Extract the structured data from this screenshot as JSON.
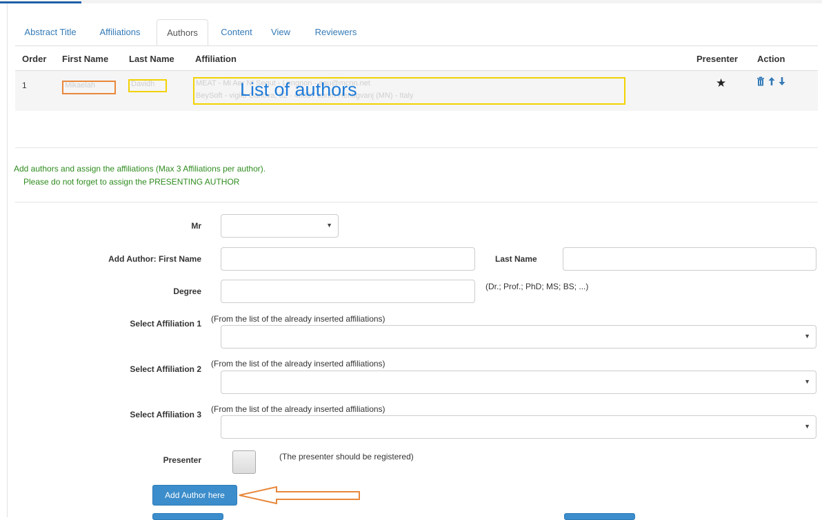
{
  "tabs": [
    {
      "label": "Abstract Title"
    },
    {
      "label": "Affiliations"
    },
    {
      "label": "Authors"
    },
    {
      "label": "Content"
    },
    {
      "label": "View"
    },
    {
      "label": "Reviewers"
    }
  ],
  "table": {
    "headers": {
      "order": "Order",
      "first_name": "First Name",
      "last_name": "Last Name",
      "affiliation": "Affiliation",
      "presenter": "Presenter",
      "action": "Action"
    },
    "rows": [
      {
        "order": "1",
        "first_name": "Mikaelah",
        "last_name": "Davidh",
        "affiliation_line1": "MEAT - Mi          Aer         Nl        Segut - Lengnon - aau@mcnn.net",
        "affiliation_line2": "BeySoft -                                            vigilo Canova, 62 - 46087 conm Hentigvanj (MN) - Italy",
        "presenter_icon": "star-icon"
      }
    ],
    "annotation": "List of authors"
  },
  "notes": {
    "line1": "Add authors and assign the affiliations (Max 3 Affiliations per author).",
    "line2": "Please do not forget to assign the PRESENTING AUTHOR"
  },
  "form": {
    "title_label": "Mr",
    "title_value": "",
    "first_name_label": "Add Author: First Name",
    "first_name_value": "",
    "last_name_label": "Last Name",
    "last_name_value": "",
    "degree_label": "Degree",
    "degree_value": "",
    "degree_hint": "(Dr.; Prof.; PhD; MS; BS; ...)",
    "affiliations": [
      {
        "label": "Select Affiliation 1",
        "hint": "(From the list of the already inserted affiliations)",
        "value": ""
      },
      {
        "label": "Select Affiliation 2",
        "hint": "(From the list of the already inserted affiliations)",
        "value": ""
      },
      {
        "label": "Select Affiliation 3",
        "hint": "(From the list of the already inserted affiliations)",
        "value": ""
      }
    ],
    "presenter_label": "Presenter",
    "presenter_hint": "(The presenter should be registered)",
    "add_button": "Add Author here"
  },
  "colors": {
    "link": "#337ab7",
    "note_green": "#2e8b1e",
    "button_blue": "#3c8dcb",
    "annotation_orange": "#e8873a",
    "annotation_yellow": "#f2d100"
  }
}
